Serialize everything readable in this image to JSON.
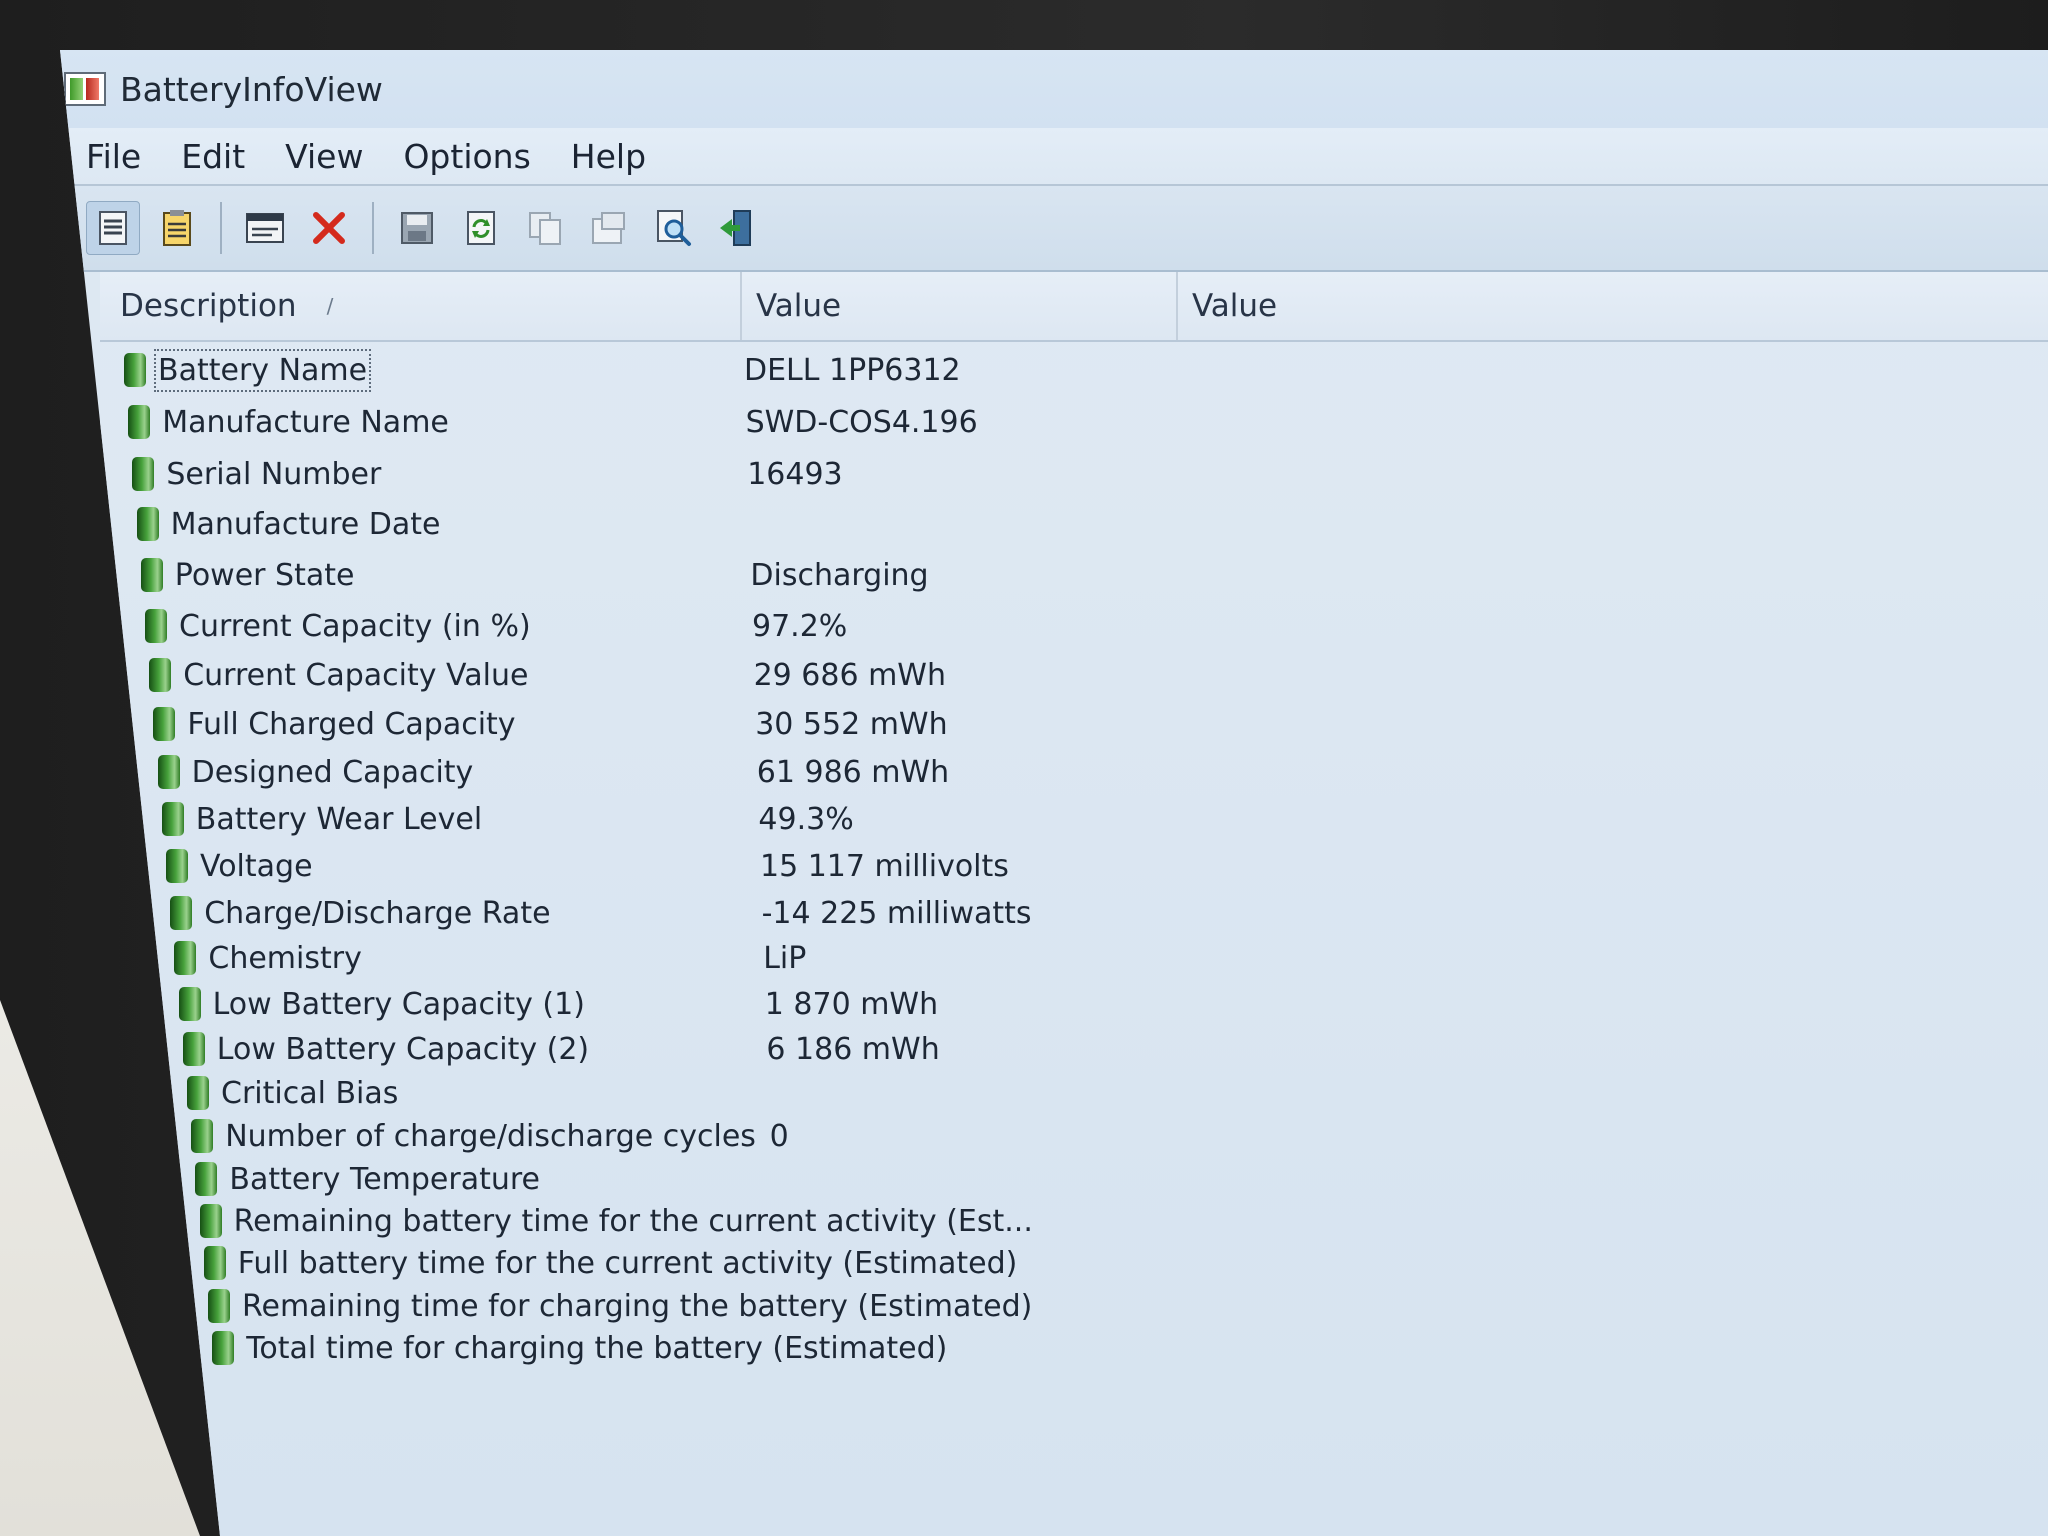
{
  "window": {
    "title": "BatteryInfoView"
  },
  "menu": [
    "File",
    "Edit",
    "View",
    "Options",
    "Help"
  ],
  "toolbar": {
    "icons": [
      "details-view-icon",
      "list-view-icon",
      "html-report-icon",
      "delete-icon",
      "save-icon",
      "refresh-icon",
      "copy-icon",
      "properties-icon",
      "find-icon",
      "exit-icon"
    ]
  },
  "columns": {
    "description": "Description",
    "value": "Value",
    "value2": "Value"
  },
  "rows": [
    {
      "description": "Battery Name",
      "value": "DELL 1PP6312",
      "value2": ""
    },
    {
      "description": "Manufacture Name",
      "value": "SWD-COS4.196",
      "value2": ""
    },
    {
      "description": "Serial Number",
      "value": "16493",
      "value2": ""
    },
    {
      "description": "Manufacture Date",
      "value": "",
      "value2": ""
    },
    {
      "description": "Power State",
      "value": "Discharging",
      "value2": ""
    },
    {
      "description": "Current Capacity (in %)",
      "value": "97.2%",
      "value2": ""
    },
    {
      "description": "Current Capacity Value",
      "value": "29 686 mWh",
      "value2": ""
    },
    {
      "description": "Full Charged Capacity",
      "value": "30 552 mWh",
      "value2": ""
    },
    {
      "description": "Designed Capacity",
      "value": "61 986 mWh",
      "value2": ""
    },
    {
      "description": "Battery Wear Level",
      "value": "49.3%",
      "value2": ""
    },
    {
      "description": "Voltage",
      "value": "15 117 millivolts",
      "value2": ""
    },
    {
      "description": "Charge/Discharge Rate",
      "value": "-14 225 milliwatts",
      "value2": ""
    },
    {
      "description": "Chemistry",
      "value": "LiP",
      "value2": ""
    },
    {
      "description": "Low Battery Capacity (1)",
      "value": "1 870 mWh",
      "value2": ""
    },
    {
      "description": "Low Battery Capacity (2)",
      "value": "6 186 mWh",
      "value2": ""
    },
    {
      "description": "Critical Bias",
      "value": "",
      "value2": ""
    },
    {
      "description": "Number of charge/discharge cycles",
      "value": "0",
      "value2": ""
    },
    {
      "description": "Battery Temperature",
      "value": "",
      "value2": ""
    },
    {
      "description": "Remaining battery time for the current activity (Est...",
      "value": "",
      "value2": ""
    },
    {
      "description": "Full battery time for the current activity (Estimated)",
      "value": "",
      "value2": ""
    },
    {
      "description": "Remaining time for charging the battery (Estimated)",
      "value": "",
      "value2": ""
    },
    {
      "description": "Total  time for charging the battery (Estimated)",
      "value": "",
      "value2": ""
    }
  ],
  "selected_row": 0
}
